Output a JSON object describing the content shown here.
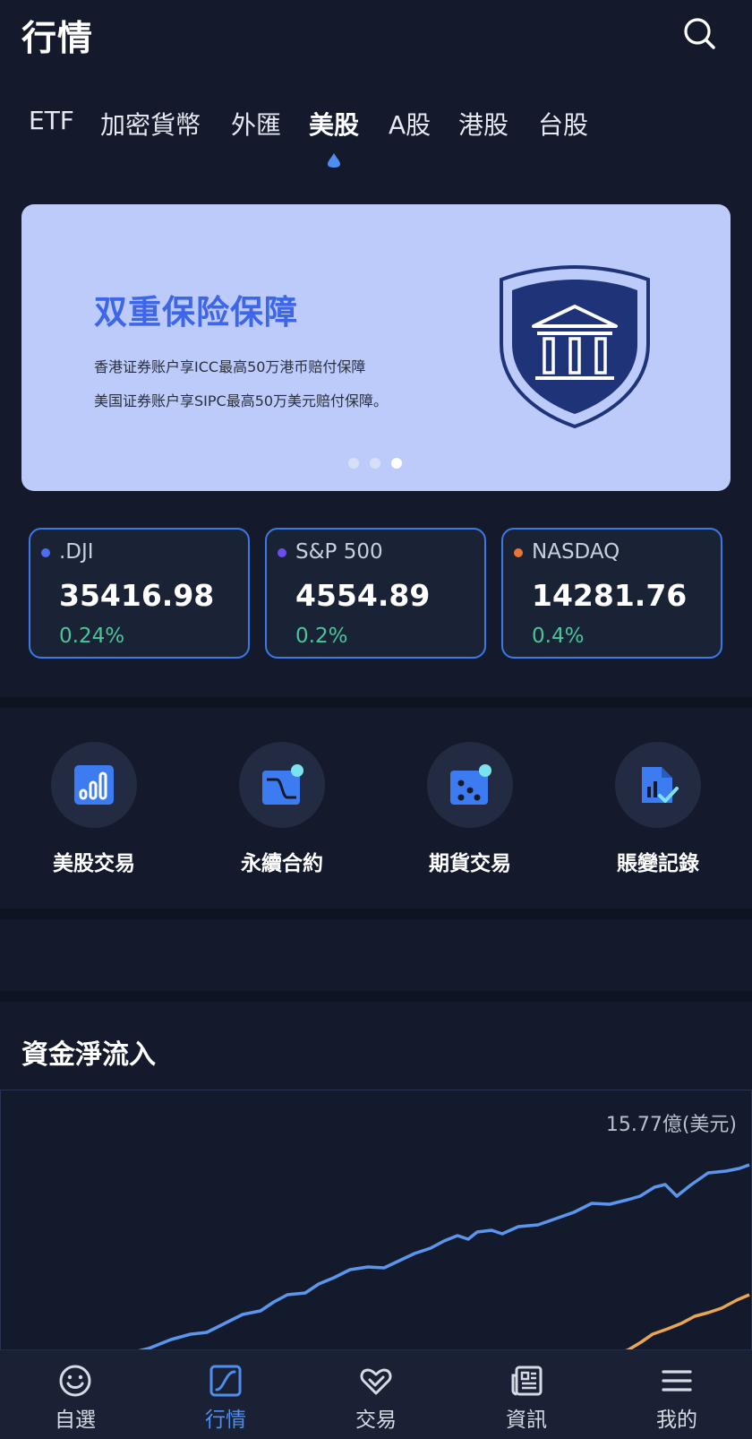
{
  "header": {
    "title": "行情",
    "search_icon": "search-icon"
  },
  "tabs": [
    {
      "label": "ETF",
      "active": false
    },
    {
      "label": "加密貨幣",
      "active": false
    },
    {
      "label": "外匯",
      "active": false
    },
    {
      "label": "美股",
      "active": true
    },
    {
      "label": "A股",
      "active": false
    },
    {
      "label": "港股",
      "active": false
    },
    {
      "label": "台股",
      "active": false
    }
  ],
  "banner": {
    "title": "双重保险保障",
    "line1": "香港证券账户享ICC最高50万港币赔付保障",
    "line2": "美国证券账户享SIPC最高50万美元赔付保障。",
    "icon": "bank-shield-icon",
    "slide_count": 3,
    "active_slide": 3
  },
  "indices": [
    {
      "name": ".DJI",
      "value": "35416.98",
      "change": "0.24%",
      "dot_color": "#4d6ef0"
    },
    {
      "name": "S&P 500",
      "value": "4554.89",
      "change": "0.2%",
      "dot_color": "#6a4ef0"
    },
    {
      "name": "NASDAQ",
      "value": "14281.76",
      "change": "0.4%",
      "dot_color": "#e8743a"
    }
  ],
  "actions": [
    {
      "label": "美股交易",
      "icon": "bar-chart-icon"
    },
    {
      "label": "永續合約",
      "icon": "curve-chart-icon"
    },
    {
      "label": "期貨交易",
      "icon": "dots-card-icon"
    },
    {
      "label": "賬變記錄",
      "icon": "document-check-icon"
    }
  ],
  "inflow": {
    "title": "資金淨流入",
    "max_label": "15.77億(美元)"
  },
  "colors": {
    "accent": "#4d8ef0",
    "positive": "#4ac49b",
    "series_blue": "#5b96ec",
    "series_orange": "#e9a552"
  },
  "nav": [
    {
      "label": "自選",
      "icon": "smile-icon",
      "active": false
    },
    {
      "label": "行情",
      "icon": "market-chart-icon",
      "active": true
    },
    {
      "label": "交易",
      "icon": "handshake-icon",
      "active": false
    },
    {
      "label": "資訊",
      "icon": "news-icon",
      "active": false
    },
    {
      "label": "我的",
      "icon": "menu-icon",
      "active": false
    }
  ]
}
